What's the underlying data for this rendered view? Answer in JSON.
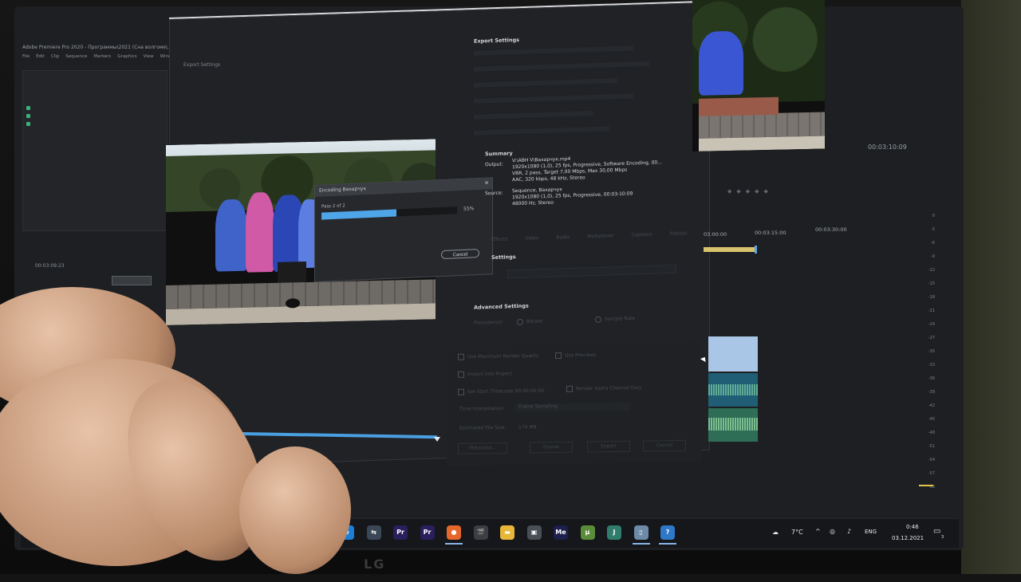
{
  "app": {
    "title": "Adobe Premiere Pro 2020 - Программы\\2021 (Сна волгоме\\.prproj)",
    "menus": [
      "File",
      "Edit",
      "Clip",
      "Sequence",
      "Markers",
      "Graphics",
      "View",
      "Window",
      "Help"
    ]
  },
  "export_window": {
    "title": "Export Settings",
    "settings_header": "Export Settings",
    "summary_header": "Summary",
    "output_label": "Output:",
    "output_lines": [
      "V:\\АВН V\\Вахарчук.mp4",
      "1920x1080 (1,0), 25 fps, Progressive, Software Encoding, 00...",
      "VBR, 2 pass, Target 7,00 Mbps, Max 30,00 Mbps",
      "AAC, 320 kbps, 48 kHz, Stereo"
    ],
    "source_label": "Source:",
    "source_lines": [
      "Sequence, Вахарчук",
      "1920x1080 (1,0), 25 fps, Progressive, 00:03:10:09",
      "48000 Hz, Stereo"
    ],
    "tabs": [
      "Effects",
      "Video",
      "Audio",
      "Multiplexer",
      "Captions",
      "Publish"
    ],
    "settings_label": "Settings",
    "advanced_label": "Advanced Settings",
    "precedence_label": "Precedence:",
    "bitrate_option": "Bitrate",
    "sample_rate_option": "Sample Rate",
    "checkboxes": [
      "Use Maximum Render Quality",
      "Use Previews",
      "Import into Project",
      "Set Start Timecode",
      "Render Alpha Channel Only"
    ],
    "start_timecode": "00:00:00:00",
    "time_interpolation_label": "Time Interpolation",
    "time_interpolation_value": "Frame Sampling",
    "file_size_label": "Estimated File Size:",
    "file_size_value": "174 MB",
    "buttons": [
      "Metadata...",
      "Queue",
      "Export",
      "Cancel"
    ]
  },
  "encoding_dialog": {
    "title": "Encoding Вахарчук",
    "pass_text": "Pass 2 of 2",
    "progress_percent": 55,
    "progress_text": "55%",
    "cancel_label": "Cancel"
  },
  "timeline": {
    "program_timecode": "00:03:10:09",
    "ruler_labels": [
      "03:00:00",
      "00:03:15:00",
      "00:03:30:00"
    ],
    "source_timecode": "00:03:09:23",
    "meter_ticks": [
      "0",
      "-3",
      "-6",
      "-9",
      "-12",
      "-15",
      "-18",
      "-21",
      "-24",
      "-27",
      "-30",
      "-33",
      "-36",
      "-39",
      "-42",
      "-45",
      "-48",
      "-51",
      "-54",
      "-57",
      "dB"
    ]
  },
  "taskbar": {
    "weather": "7°C",
    "language": "ENG",
    "time": "0:46",
    "date": "03.12.2021",
    "notification_count": "3",
    "apps": [
      {
        "name": "edge",
        "label": "e",
        "color": "#1c7fd6"
      },
      {
        "name": "network",
        "label": "⇆",
        "color": "#3b4756"
      },
      {
        "name": "premiere",
        "label": "Pr",
        "color": "#2a1e5c"
      },
      {
        "name": "premiere-2",
        "label": "Pr",
        "color": "#2a1e5c"
      },
      {
        "name": "firefox",
        "label": "●",
        "color": "#e5672b"
      },
      {
        "name": "clapper",
        "label": "🎬",
        "color": "#3b3f45"
      },
      {
        "name": "folder",
        "label": "▬",
        "color": "#e8b739"
      },
      {
        "name": "photo",
        "label": "▣",
        "color": "#4a4e55"
      },
      {
        "name": "media-encoder",
        "label": "Me",
        "color": "#1d1f4d"
      },
      {
        "name": "utorrent",
        "label": "µ",
        "color": "#5a8c3a"
      },
      {
        "name": "j-app",
        "label": "J",
        "color": "#2f7d6a"
      },
      {
        "name": "doc",
        "label": "▯",
        "color": "#6d8aa8"
      },
      {
        "name": "help",
        "label": "?",
        "color": "#2f78c8"
      }
    ]
  },
  "monitor_brand": "LG",
  "colors": {
    "progress": "#4ea6e8",
    "accent": "#8ab4e8"
  }
}
